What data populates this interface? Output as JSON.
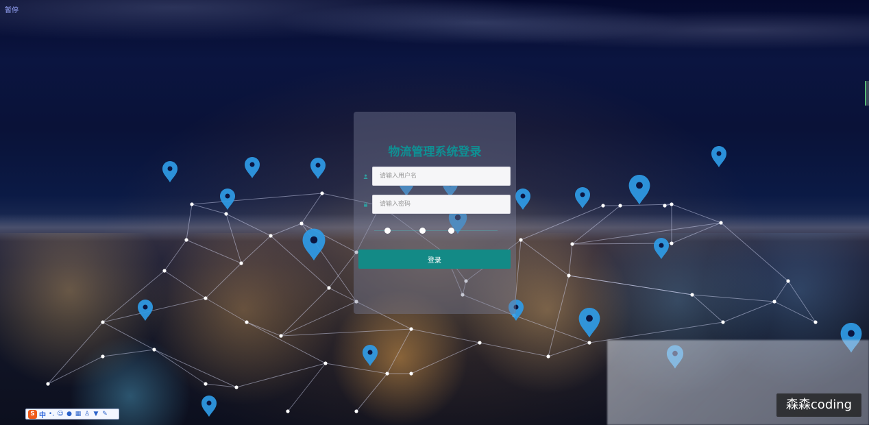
{
  "pause_label": "暂停",
  "login": {
    "title": "物流管理系统登录",
    "username_placeholder": "请输入用户名",
    "password_placeholder": "请输入密码",
    "submit_label": "登录"
  },
  "ime_toolbar": {
    "logo": "S",
    "mode": "中",
    "icons": [
      "punctuation-icon",
      "emoji-icon",
      "microphone-icon",
      "keyboard-icon",
      "person-icon",
      "shirt-icon",
      "wrench-icon"
    ]
  },
  "watermark": "森森coding",
  "colors": {
    "accent": "#138a86",
    "title": "#0f8f93",
    "pin": "#2f9be6",
    "panel": "rgba(120,125,150,0.42)"
  }
}
